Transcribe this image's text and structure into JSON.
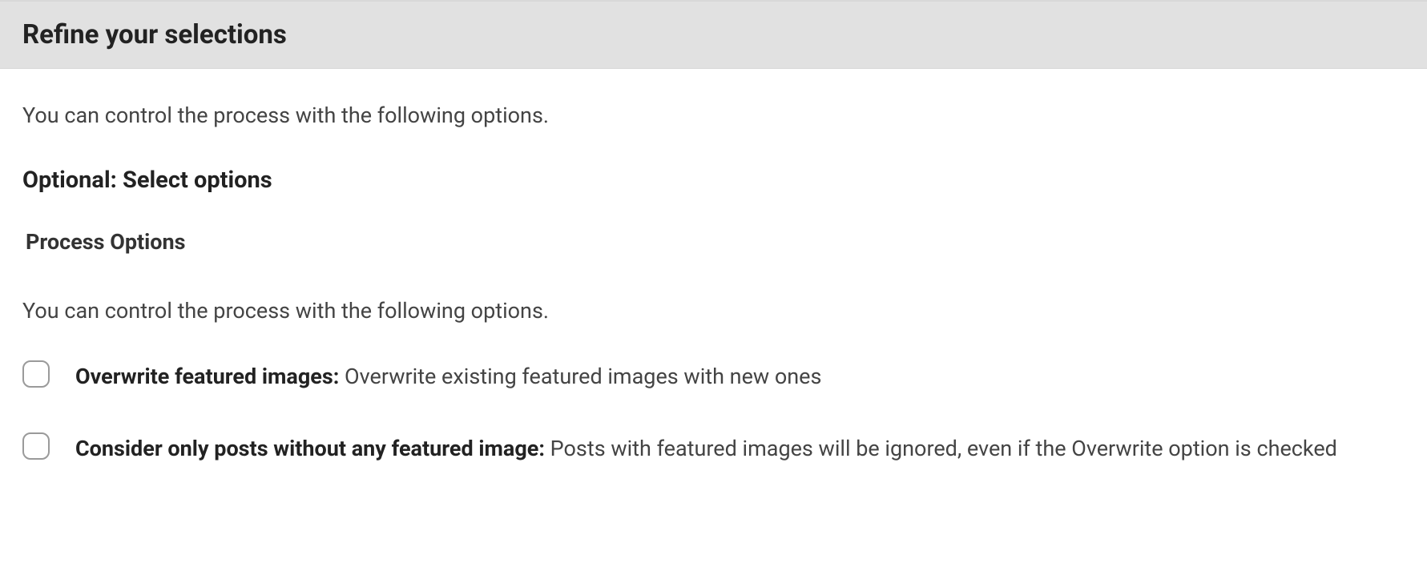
{
  "header": {
    "title": "Refine your selections"
  },
  "intro": "You can control the process with the following options.",
  "subheading": "Optional: Select options",
  "section": {
    "label": "Process Options",
    "desc": "You can control the process with the following options."
  },
  "options": [
    {
      "bold": "Overwrite featured images:",
      "desc": " Overwrite existing featured images with new ones"
    },
    {
      "bold": "Consider only posts without any featured image:",
      "desc": " Posts with featured images will be ignored, even if the Overwrite option is checked"
    }
  ]
}
